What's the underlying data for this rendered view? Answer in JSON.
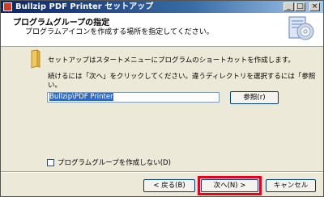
{
  "window": {
    "title": "Bullzip PDF Printer セットアップ"
  },
  "title_buttons": {
    "minimize": "_",
    "maximize": "□",
    "close": "×"
  },
  "header": {
    "title": "プログラムグループの指定",
    "subtitle": "プログラムアイコンを作成する場所を指定してください。"
  },
  "body": {
    "intro": "セットアップはスタートメニューにプログラムのショートカットを作成します。",
    "instruction_line1": "続けるには「次へ」をクリックしてください。違うディレクトリを選択するには「参照」をクリックしてくださ",
    "instruction_line2": "い。"
  },
  "group_input": {
    "value": "Bullzip\\PDF Printer"
  },
  "buttons": {
    "browse": "参照(r)",
    "back": "< 戻る(B)",
    "next": "次へ(N) >",
    "cancel": "キャンセル"
  },
  "checkbox": {
    "label": "プログラムグループを作成しない(D)",
    "checked": false
  },
  "colors": {
    "titlebar": "#0a246a",
    "highlight": "#e8001c",
    "selection": "#316ac5"
  },
  "icons": [
    "app-icon",
    "setup-icon",
    "folder-icon"
  ]
}
